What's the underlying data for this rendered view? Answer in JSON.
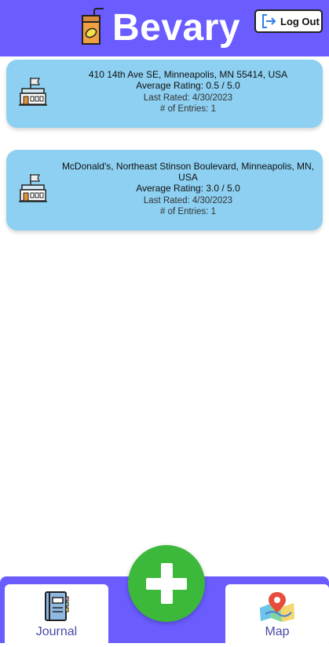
{
  "header": {
    "title": "Bevary",
    "brand_icon": "juice-box-icon",
    "logout_label": "Log Out",
    "logout_icon": "logout-arrow-icon",
    "background_color": "#6a5cff"
  },
  "locations": [
    {
      "address": "410 14th Ave SE, Minneapolis, MN 55414, USA",
      "average_rating": "Average Rating: 0.5 / 5.0",
      "last_rated": "Last Rated: 4/30/2023",
      "entries": "# of Entries: 1",
      "icon": "building-flag-icon"
    },
    {
      "address": "McDonald's, Northeast Stinson Boulevard, Minneapolis, MN, USA",
      "average_rating": "Average Rating: 3.0 / 5.0",
      "last_rated": "Last Rated: 4/30/2023",
      "entries": "# of Entries: 1",
      "icon": "building-flag-icon"
    }
  ],
  "nav": {
    "journal_label": "Journal",
    "journal_icon": "journal-book-icon",
    "map_label": "Map",
    "map_icon": "map-pin-icon",
    "add_icon": "plus-icon",
    "add_color": "#3cb93a"
  },
  "colors": {
    "card_background": "#8dd0f1"
  }
}
